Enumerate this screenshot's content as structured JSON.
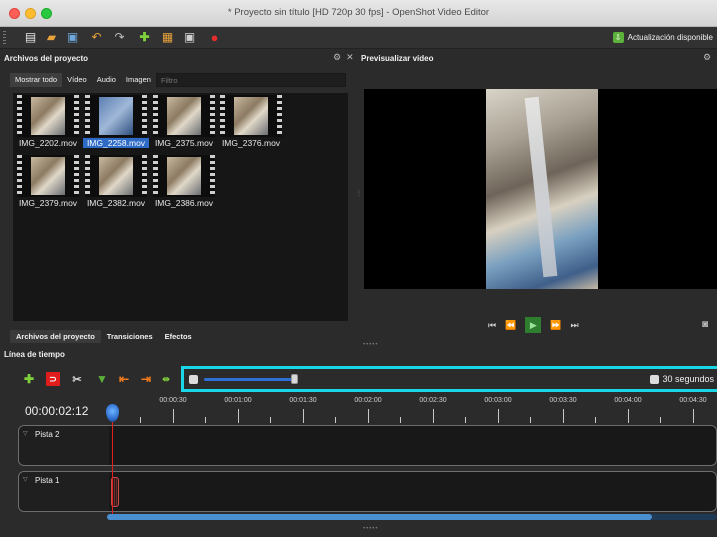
{
  "window": {
    "title": "* Proyecto sin título [HD 720p 30 fps] - OpenShot Video Editor"
  },
  "toolbar": {
    "update_label": "Actualización disponible"
  },
  "project_files": {
    "title": "Archivos del proyecto",
    "filter_tabs": [
      "Mostrar todo",
      "Vídeo",
      "Audio",
      "Imagen"
    ],
    "filter_placeholder": "Filtro",
    "files": [
      {
        "name": "IMG_2202.mov",
        "selected": false
      },
      {
        "name": "IMG_2258.mov",
        "selected": true
      },
      {
        "name": "IMG_2375.mov",
        "selected": false
      },
      {
        "name": "IMG_2376.mov",
        "selected": false
      },
      {
        "name": "IMG_2379.mov",
        "selected": false
      },
      {
        "name": "IMG_2382.mov",
        "selected": false
      },
      {
        "name": "IMG_2386.mov",
        "selected": false
      }
    ],
    "bottom_tabs": [
      "Archivos del proyecto",
      "Transiciones",
      "Efectos"
    ]
  },
  "preview": {
    "title": "Previsualizar vídeo"
  },
  "timeline": {
    "title": "Línea de tiempo",
    "timecode": "00:00:02:12",
    "zoom_label": "30 segundos",
    "ruler_labels": [
      "00:00:30",
      "00:01:00",
      "00:01:30",
      "00:02:00",
      "00:02:30",
      "00:03:00",
      "00:03:30",
      "00:04:00",
      "00:04:30"
    ],
    "tracks": [
      {
        "name": "Pista 2"
      },
      {
        "name": "Pista 1"
      }
    ]
  },
  "colors": {
    "accent_highlight": "#18d6e6",
    "selection": "#2d6bc7",
    "playhead": "#e02020",
    "play_button": "#2f7d2f"
  }
}
